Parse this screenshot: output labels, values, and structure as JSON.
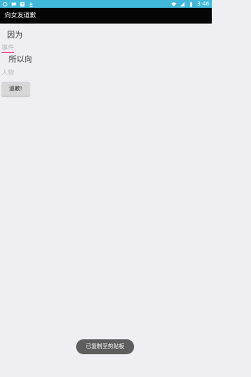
{
  "status_bar": {
    "time": "3:46",
    "icons": [
      "notification-icon",
      "chat-icon",
      "text-icon",
      "download-icon",
      "wifi-icon",
      "signal-icon",
      "battery-icon"
    ]
  },
  "toolbar": {
    "title": "向女友道歉"
  },
  "form": {
    "label_because": "因为",
    "input_reason_placeholder": "事件",
    "label_so_to": "所以向",
    "input_person_placeholder": "人物",
    "apologize_button": "道歉!"
  },
  "toast": {
    "message": "已复制至剪贴板"
  },
  "colors": {
    "status_bar": "#3FB8DA",
    "toolbar": "#050505",
    "background": "#EFEEF3",
    "accent": "#E91E63",
    "toast": "#5E5E5E"
  }
}
